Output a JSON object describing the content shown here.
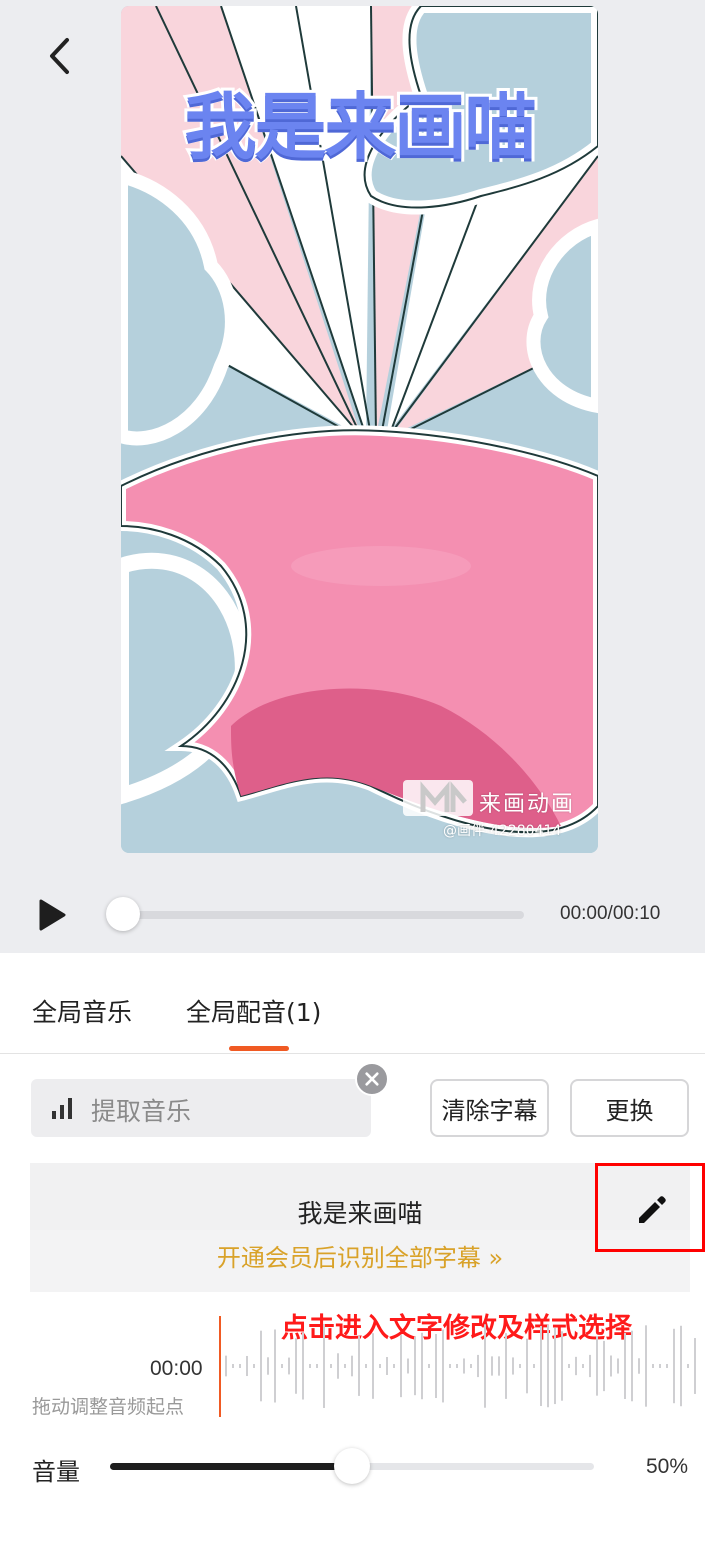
{
  "preview": {
    "video_title": "我是来画喵",
    "watermark_brand": "来画动画",
    "watermark_id": "@画伴-42280414"
  },
  "player": {
    "time": "00:00/00:10",
    "progress": 0.0
  },
  "tabs": [
    {
      "label": "全局音乐",
      "active": false
    },
    {
      "label": "全局配音(1)",
      "active": true
    }
  ],
  "audio_controls": {
    "extract_label": "提取音乐",
    "clear_subtitles_label": "清除字幕",
    "replace_label": "更换"
  },
  "subtitle_card": {
    "text": "我是来画喵",
    "vip_link": "开通会员后识别全部字幕 »"
  },
  "annotation": "点击进入文字修改及样式选择",
  "waveform": {
    "start_time": "00:00",
    "hint": "拖动调整音频起点"
  },
  "volume": {
    "label": "音量",
    "value_text": "50%",
    "level": 0.5
  },
  "colors": {
    "accent": "#f05a23",
    "vip_gold": "#d9a229",
    "highlight_red": "#ff0000"
  },
  "icons": [
    "back-icon",
    "play-icon",
    "bars-icon",
    "close-icon",
    "pencil-icon"
  ]
}
